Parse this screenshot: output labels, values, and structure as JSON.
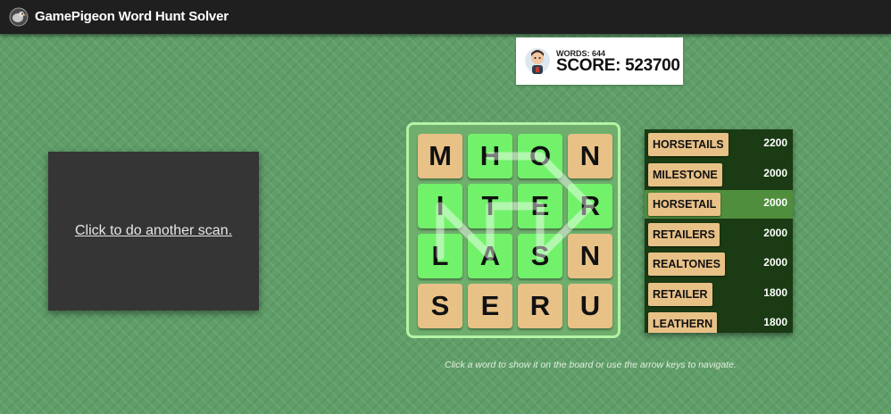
{
  "app": {
    "title": "GamePigeon Word Hunt Solver",
    "logo_icon": "pigeon-icon"
  },
  "scorecard": {
    "words_text": "WORDS: 644",
    "score_text": "SCORE: 523700",
    "avatar_icon": "pigeon-avatar-icon"
  },
  "scan_panel": {
    "link_text": "Click to do another scan."
  },
  "board": {
    "tiles": [
      {
        "letter": "M",
        "state": "plain"
      },
      {
        "letter": "H",
        "state": "active"
      },
      {
        "letter": "O",
        "state": "active"
      },
      {
        "letter": "N",
        "state": "plain"
      },
      {
        "letter": "I",
        "state": "active"
      },
      {
        "letter": "T",
        "state": "active"
      },
      {
        "letter": "E",
        "state": "active"
      },
      {
        "letter": "R",
        "state": "active"
      },
      {
        "letter": "L",
        "state": "active"
      },
      {
        "letter": "A",
        "state": "active"
      },
      {
        "letter": "S",
        "state": "active"
      },
      {
        "letter": "N",
        "state": "plain"
      },
      {
        "letter": "S",
        "state": "plain"
      },
      {
        "letter": "E",
        "state": "plain"
      },
      {
        "letter": "R",
        "state": "plain"
      },
      {
        "letter": "U",
        "state": "plain"
      }
    ],
    "highlighted_word": "HORSETAIL",
    "path_cells": [
      1,
      2,
      7,
      10,
      6,
      5,
      9,
      4,
      8
    ],
    "colors": {
      "active_tile": "#72f16b",
      "plain_tile": "#e8c187",
      "border": "#b3f3a3"
    }
  },
  "wordlist": {
    "words": [
      {
        "word": "HORSETAILS",
        "score": "2200",
        "selected": false
      },
      {
        "word": "MILESTONE",
        "score": "2000",
        "selected": false
      },
      {
        "word": "HORSETAIL",
        "score": "2000",
        "selected": true
      },
      {
        "word": "RETAILERS",
        "score": "2000",
        "selected": false
      },
      {
        "word": "REALTONES",
        "score": "2000",
        "selected": false
      },
      {
        "word": "RETAILER",
        "score": "1800",
        "selected": false
      },
      {
        "word": "LEATHERN",
        "score": "1800",
        "selected": false
      }
    ]
  },
  "hint": {
    "text": "Click a word to show it on the board or use the arrow keys to navigate."
  }
}
